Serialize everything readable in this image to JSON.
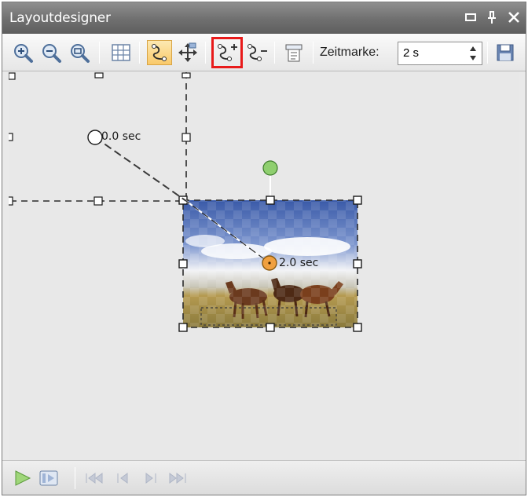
{
  "window": {
    "title": "Layoutdesigner",
    "controls": [
      "window-restore-icon",
      "pin-icon",
      "close-icon"
    ]
  },
  "toolbar": {
    "tools": [
      {
        "name": "zoom-in",
        "icon": "zoom-in-icon"
      },
      {
        "name": "zoom-out",
        "icon": "zoom-out-icon"
      },
      {
        "name": "zoom-fit",
        "icon": "zoom-fit-icon"
      },
      {
        "name": "grid",
        "icon": "grid-icon"
      },
      {
        "name": "motion-path",
        "icon": "motion-path-icon",
        "active": true
      },
      {
        "name": "move",
        "icon": "move-icon"
      },
      {
        "name": "add-keyframe",
        "icon": "add-keyframe-icon",
        "highlighted": true
      },
      {
        "name": "remove-keyframe",
        "icon": "remove-keyframe-icon"
      },
      {
        "name": "align",
        "icon": "align-icon"
      }
    ],
    "zeitmarke_label": "Zeitmarke:",
    "zeitmarke_value": "2 s",
    "save_icon": "save-icon"
  },
  "canvas": {
    "keyframes": [
      {
        "label": "0.0 sec"
      },
      {
        "label": "2.0 sec"
      }
    ],
    "image": "horses-on-grass-photo"
  },
  "playback": {
    "icons": [
      "play-icon",
      "preview-icon",
      "first-frame-icon",
      "previous-frame-icon",
      "next-frame-icon",
      "last-frame-icon"
    ]
  },
  "colors": {
    "accent_red": "#e81a1a",
    "active_tool": "#f9c96a",
    "rotation_handle": "#8fcf6f",
    "keyframe_active": "#f0a040"
  }
}
